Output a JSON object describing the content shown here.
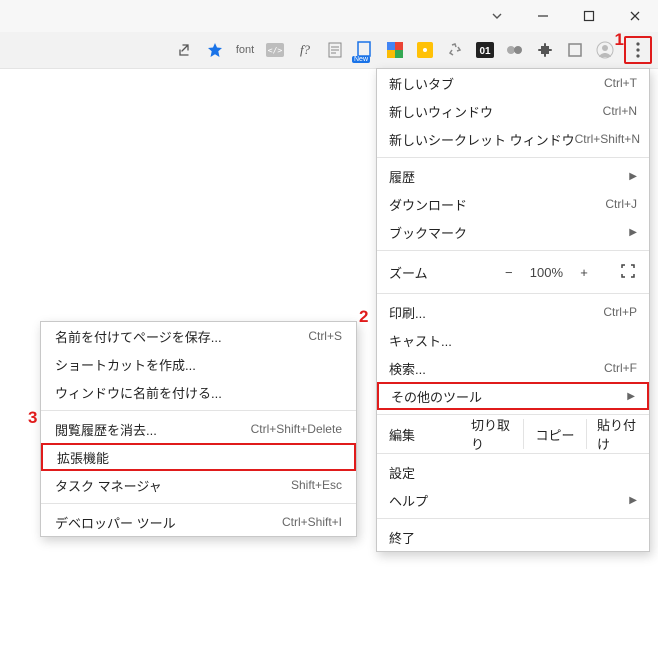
{
  "callouts": {
    "c1": "1",
    "c2": "2",
    "c3": "3"
  },
  "toolbar": {
    "font_label": "font",
    "new_badge": "New",
    "zero_one": "01"
  },
  "menu": {
    "new_tab": "新しいタブ",
    "new_tab_sc": "Ctrl+T",
    "new_window": "新しいウィンドウ",
    "new_window_sc": "Ctrl+N",
    "incognito": "新しいシークレット ウィンドウ",
    "incognito_sc": "Ctrl+Shift+N",
    "history": "履歴",
    "downloads": "ダウンロード",
    "downloads_sc": "Ctrl+J",
    "bookmarks": "ブックマーク",
    "zoom_label": "ズーム",
    "zoom_minus": "−",
    "zoom_value": "100%",
    "zoom_plus": "+",
    "print": "印刷...",
    "print_sc": "Ctrl+P",
    "cast": "キャスト...",
    "find": "検索...",
    "find_sc": "Ctrl+F",
    "more_tools": "その他のツール",
    "edit": "編集",
    "cut": "切り取り",
    "copy": "コピー",
    "paste": "貼り付け",
    "settings": "設定",
    "help": "ヘルプ",
    "exit": "終了"
  },
  "submenu": {
    "save_as": "名前を付けてページを保存...",
    "save_as_sc": "Ctrl+S",
    "shortcut": "ショートカットを作成...",
    "name_window": "ウィンドウに名前を付ける...",
    "clear_history": "閲覧履歴を消去...",
    "clear_history_sc": "Ctrl+Shift+Delete",
    "extensions": "拡張機能",
    "task_mgr": "タスク マネージャ",
    "task_mgr_sc": "Shift+Esc",
    "dev_tools": "デベロッパー ツール",
    "dev_tools_sc": "Ctrl+Shift+I"
  }
}
